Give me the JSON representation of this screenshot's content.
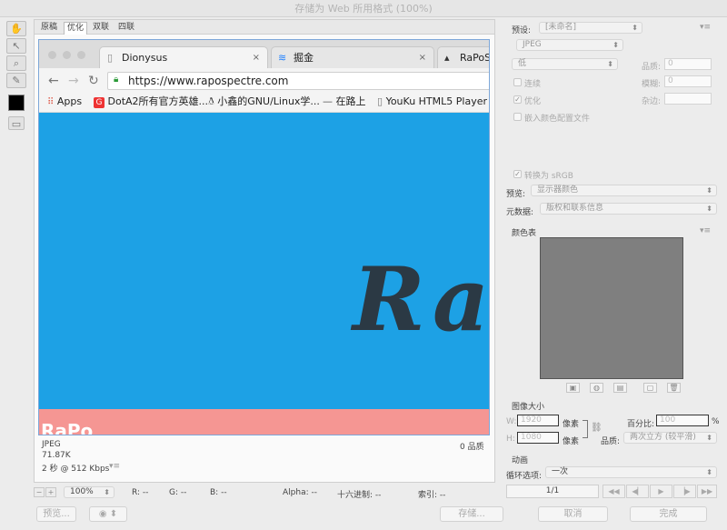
{
  "window": {
    "title": "存储为 Web 所用格式 (100%)"
  },
  "tools": {
    "hand_icon": "hand-icon",
    "slice_select_icon": "slice-select-icon",
    "zoom_icon": "zoom-icon",
    "eyedropper_icon": "eyedropper-icon",
    "color": "#000000"
  },
  "view_tabs": [
    "原稿",
    "优化",
    "双联",
    "四联"
  ],
  "browser": {
    "tabs": [
      {
        "title": "Dionysus",
        "close": "×"
      },
      {
        "title": "掘金",
        "close": "×"
      },
      {
        "title": "RaPoSp"
      }
    ],
    "url": "https://www.rapospectre.com",
    "bookmarks": [
      "Apps",
      "DotA2所有官方英雄...",
      "小鑫的GNU/Linux学...",
      "在路上",
      "YouKu HTML5 Player"
    ],
    "hero_text": "Ra",
    "footer_text": "RaPo",
    "hero_color": "#1da1e5",
    "footer_color": "#f59693"
  },
  "preview_info": {
    "format": "JPEG",
    "size": "71.87K",
    "time": "2 秒 @ 512 Kbps",
    "quality": "0 品质"
  },
  "statusbar": {
    "zoom": "100%",
    "r": "R: --",
    "g": "G: --",
    "b": "B: --",
    "alpha": "Alpha: --",
    "hex": "十六进制: --",
    "index": "索引: --"
  },
  "bottom_buttons": {
    "preview": "预览...",
    "save": "存储...",
    "cancel": "取消",
    "done": "完成"
  },
  "settings": {
    "preset_label": "预设:",
    "preset_value": "[未命名]",
    "format": "JPEG",
    "quality_level": "低",
    "quality_label": "品质:",
    "quality_value": "0",
    "progressive": "连续",
    "blur_label": "模糊:",
    "blur_value": "0",
    "optimized": "优化",
    "matte_label": "杂边:",
    "embed_profile": "嵌入颜色配置文件",
    "convert_srgb": "转换为 sRGB",
    "preview_label": "预览:",
    "preview_value": "显示器颜色",
    "metadata_label": "元数据:",
    "metadata_value": "版权和联系信息"
  },
  "color_table": {
    "title": "颜色表",
    "swatch_color": "#7f7f7f"
  },
  "image_size": {
    "title": "图像大小",
    "w_label": "W:",
    "w_value": "1920",
    "w_unit": "像素",
    "h_label": "H:",
    "h_value": "1080",
    "h_unit": "像素",
    "percent_label": "百分比:",
    "percent_value": "100",
    "percent_unit": "%",
    "quality_label": "品质:",
    "quality_value": "两次立方 (较平滑)"
  },
  "animation": {
    "title": "动画",
    "loop_label": "循环选项:",
    "loop_value": "一次",
    "frame": "1/1"
  }
}
